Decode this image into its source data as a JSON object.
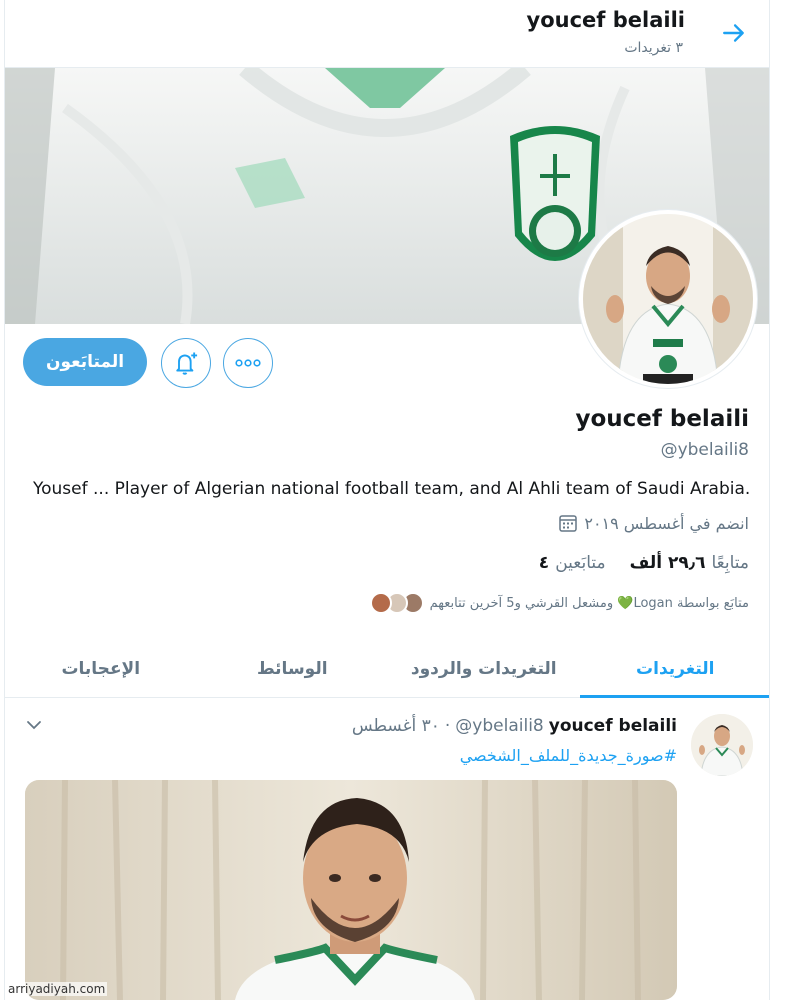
{
  "header": {
    "name": "youcef belaili",
    "tweet_count": "٣ تغريدات",
    "back_icon": "arrow-right-icon"
  },
  "profile": {
    "name": "youcef belaili",
    "handle": "@ybelaili8",
    "bio": "Yousef ... Player of Algerian national football team, and Al Ahli team of Saudi Arabia.",
    "joined": "انضم في أغسطس ٢٠١٩",
    "following_value": "٤",
    "following_label": "متابَعين",
    "followers_value": "٢٩٫٦ ألف",
    "followers_label": "متابِعًا",
    "followed_by": "متابَع بواسطة Logan💚 ومشعل القرشي و5 آخرين تتابعهم"
  },
  "actions": {
    "follow_label": "المتابَعون",
    "bell_icon": "bell-plus-icon",
    "more_icon": "more-icon"
  },
  "tabs": [
    {
      "label": "التغريدات",
      "active": true
    },
    {
      "label": "التغريدات والردود",
      "active": false
    },
    {
      "label": "الوسائط",
      "active": false
    },
    {
      "label": "الإعجابات",
      "active": false
    }
  ],
  "tweet": {
    "author": "youcef belaili",
    "handle": "@ybelaili8",
    "separator": "·",
    "date": "٣٠ أغسطس",
    "text": "#صورة_جديدة_للملف_الشخصي"
  },
  "watermark": "arriyadiyah.com",
  "colors": {
    "accent": "#1da1f2",
    "button": "#4aa7e2",
    "secondary_text": "#657786"
  }
}
